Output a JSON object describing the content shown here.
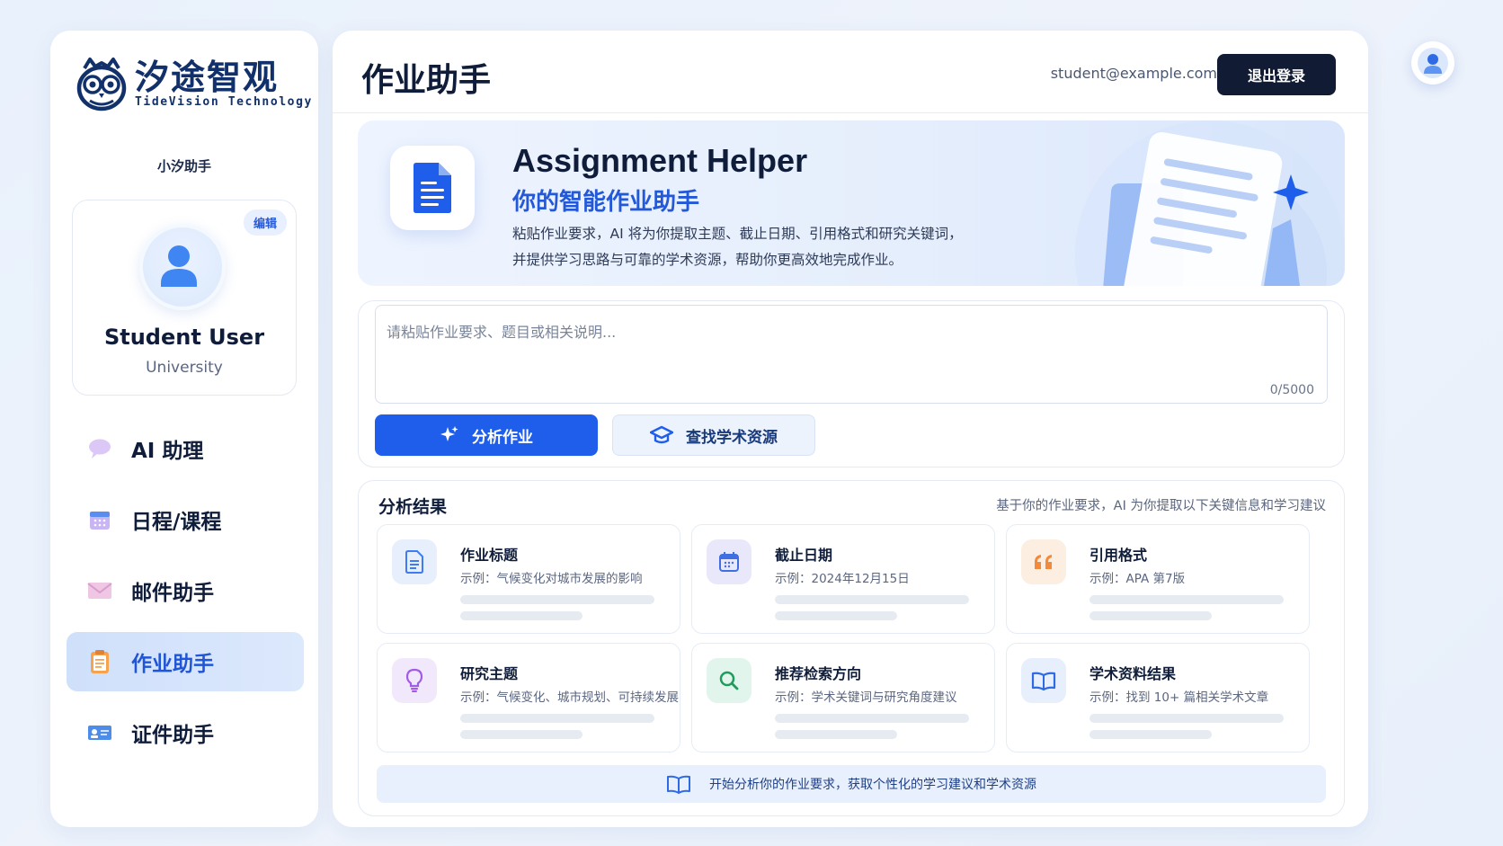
{
  "brand": {
    "name_cn": "汐途智观",
    "name_en": "TideVision Technology",
    "sub": "小汐助手"
  },
  "profile": {
    "edit_label": "编辑",
    "name": "Student User",
    "org": "University"
  },
  "nav": {
    "items": [
      {
        "label": "AI 助理",
        "icon": "chat-bubble-icon",
        "active": false
      },
      {
        "label": "日程/课程",
        "icon": "calendar-icon",
        "active": false
      },
      {
        "label": "邮件助手",
        "icon": "envelope-icon",
        "active": false
      },
      {
        "label": "作业助手",
        "icon": "clipboard-icon",
        "active": true
      },
      {
        "label": "证件助手",
        "icon": "id-card-icon",
        "active": false
      }
    ]
  },
  "header": {
    "title": "作业助手",
    "email": "student@example.com",
    "logout_label": "退出登录"
  },
  "hero": {
    "title": "Assignment Helper",
    "subtitle": "你的智能作业助手",
    "desc_line1": "粘贴作业要求，AI 将为你提取主题、截止日期、引用格式和研究关键词，",
    "desc_line2": "并提供学习思路与可靠的学术资源，帮助你更高效地完成作业。"
  },
  "input": {
    "placeholder": "请粘贴作业要求、题目或相关说明...",
    "count": "0/5000",
    "analyze_label": "分析作业",
    "resource_label": "查找学术资源"
  },
  "results": {
    "title": "分析结果",
    "hint": "基于你的作业要求，AI 为你提取以下关键信息和学习建议",
    "cards": [
      {
        "title": "作业标题",
        "example": "示例：气候变化对城市发展的影响",
        "icon": "document-icon"
      },
      {
        "title": "截止日期",
        "example": "示例：2024年12月15日",
        "icon": "calendar-icon"
      },
      {
        "title": "引用格式",
        "example": "示例：APA 第7版",
        "icon": "quote-icon"
      },
      {
        "title": "研究主题",
        "example": "示例：气候变化、城市规划、可持续发展",
        "icon": "lightbulb-icon"
      },
      {
        "title": "推荐检索方向",
        "example": "示例：学术关键词与研究角度建议",
        "icon": "search-icon"
      },
      {
        "title": "学术资料结果",
        "example": "示例：找到 10+ 篇相关学术文章",
        "icon": "book-icon"
      }
    ],
    "tip": "开始分析你的作业要求，获取个性化的学习建议和学术资源"
  },
  "colors": {
    "accent": "#1f5eea",
    "dark_button": "#111b33",
    "active_nav_bg": "#d4e3fb"
  }
}
